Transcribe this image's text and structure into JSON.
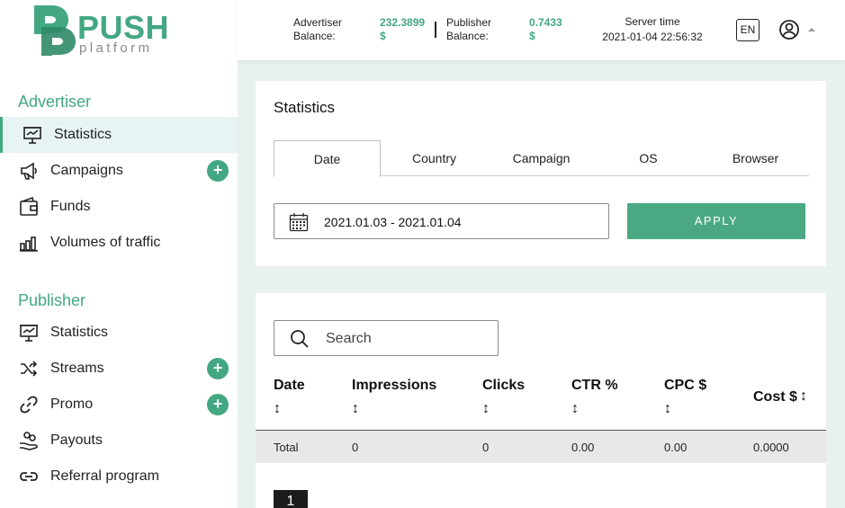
{
  "brand": {
    "logo_word": "PUSH",
    "logo_sub": "platform",
    "accent": "#43a881"
  },
  "sidebar": {
    "advertiser_title": "Advertiser",
    "advertiser_items": [
      {
        "label": "Statistics",
        "icon": "presentation-chart-icon",
        "active": true
      },
      {
        "label": "Campaigns",
        "icon": "megaphone-icon",
        "has_add": true
      },
      {
        "label": "Funds",
        "icon": "wallet-icon"
      },
      {
        "label": "Volumes of traffic",
        "icon": "bar-chart-icon"
      }
    ],
    "publisher_title": "Publisher",
    "publisher_items": [
      {
        "label": "Statistics",
        "icon": "presentation-chart-icon"
      },
      {
        "label": "Streams",
        "icon": "shuffle-icon",
        "has_add": true
      },
      {
        "label": "Promo",
        "icon": "link-icon",
        "has_add": true
      },
      {
        "label": "Payouts",
        "icon": "hand-coins-icon"
      },
      {
        "label": "Referral program",
        "icon": "chain-link-icon"
      }
    ],
    "add_symbol": "+"
  },
  "header": {
    "advertiser_balance_label": "Advertiser Balance:",
    "advertiser_balance_line1": "Advertiser",
    "advertiser_balance_line2": "Balance:",
    "advertiser_balance_value": "232.3899",
    "advertiser_balance_currency": "$",
    "publisher_balance_line1": "Publisher",
    "publisher_balance_line2": "Balance:",
    "publisher_balance_value": "0.7433",
    "publisher_balance_currency": "$",
    "server_time_label": "Server time",
    "server_time_value": "2021-01-04 22:56:32",
    "language": "EN"
  },
  "statistics": {
    "title": "Statistics",
    "tabs": [
      "Date",
      "Country",
      "Campaign",
      "OS",
      "Browser"
    ],
    "date_range": "2021.01.03 - 2021.01.04",
    "apply_label": "APPLY"
  },
  "table": {
    "search_placeholder": "Search",
    "columns": [
      "Date",
      "Impressions",
      "Clicks",
      "CTR %",
      "CPC $",
      "Cost $"
    ],
    "sort_symbol": "↕",
    "total_row": [
      "Total",
      "0",
      "0",
      "0.00",
      "0.00",
      "0.0000"
    ],
    "current_page": "1"
  }
}
